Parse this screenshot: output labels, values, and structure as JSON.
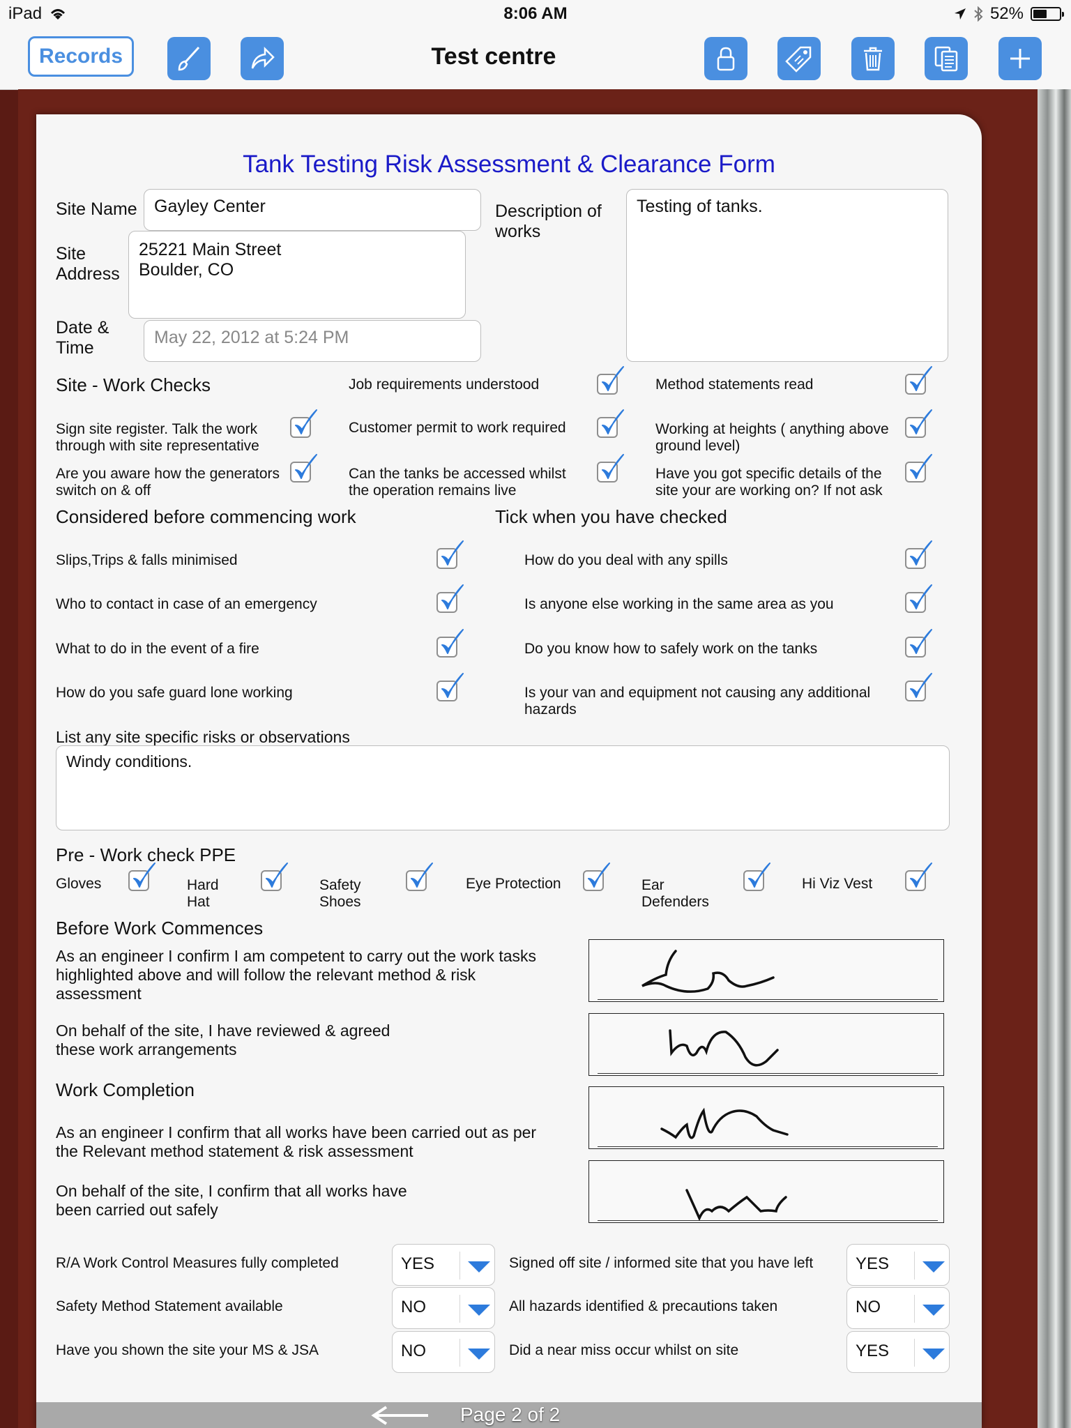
{
  "status_bar": {
    "device": "iPad",
    "time": "8:06 AM",
    "battery": "52%",
    "battery_level": 0.52
  },
  "toolbar": {
    "records_label": "Records",
    "title": "Test centre"
  },
  "form": {
    "title": "Tank Testing Risk Assessment & Clearance Form",
    "site_name_label": "Site Name",
    "site_name_value": "Gayley Center",
    "site_address_label": "Site\nAddress",
    "site_address_value": "25221 Main Street\nBoulder, CO",
    "datetime_label": "Date &\nTime",
    "datetime_value": "May 22, 2012 at 5:24 PM",
    "description_label": "Description of\nworks",
    "description_value": "Testing of tanks.",
    "site_checks_header": "Site - Work Checks",
    "site_checks": [
      {
        "label": "Job requirements understood",
        "checked": true
      },
      {
        "label": "Method statements read",
        "checked": true
      },
      {
        "label": "Sign site register. Talk the work\nthrough with site representative",
        "checked": true
      },
      {
        "label": "Customer permit to work required",
        "checked": true
      },
      {
        "label": "Working at heights ( anything above\nground level)",
        "checked": true
      },
      {
        "label": "Are you aware how the generators\nswitch on & off",
        "checked": true
      },
      {
        "label": "Can the tanks be accessed whilst\nthe operation remains live",
        "checked": true
      },
      {
        "label": "Have you got specific details of the\nsite your are working on? If not ask",
        "checked": true
      }
    ],
    "considered_header": "Considered before commencing work",
    "tick_header": "Tick when you have checked",
    "considered_checks": [
      {
        "label": "Slips,Trips & falls minimised",
        "checked": true
      },
      {
        "label": "Who to contact in case of an emergency",
        "checked": true
      },
      {
        "label": "What to do in the event of a fire",
        "checked": true
      },
      {
        "label": "How do you safe guard lone working",
        "checked": true
      },
      {
        "label": "How do you deal with any spills",
        "checked": true
      },
      {
        "label": "Is anyone else working in the same area as you",
        "checked": true
      },
      {
        "label": "Do you know how to safely work on the tanks",
        "checked": true
      },
      {
        "label": "Is your van and equipment not causing any additional\nhazards",
        "checked": true
      }
    ],
    "risks_label": "List any site specific risks or observations",
    "risks_value": "Windy conditions.",
    "ppe_header": "Pre - Work check PPE",
    "ppe": [
      {
        "label": "Gloves",
        "checked": true
      },
      {
        "label": "Hard\nHat",
        "checked": true
      },
      {
        "label": "Safety\nShoes",
        "checked": true
      },
      {
        "label": "Eye Protection",
        "checked": true
      },
      {
        "label": "Ear\nDefenders",
        "checked": true
      },
      {
        "label": "Hi Viz Vest",
        "checked": true
      }
    ],
    "before_header": "Before Work Commences",
    "engineer_confirm": "As an engineer I confirm I am competent to carry out the work tasks\nhighlighted above and will follow the relevant method & risk\nassessment",
    "site_agree": "On behalf of the site, I have reviewed & agreed\nthese work arrangements",
    "completion_header": "Work Completion",
    "engineer_complete": "As an engineer I confirm that all works have been carried out as per\nthe Relevant method statement & risk assessment",
    "site_complete": "On behalf of the site, I confirm that all works have\nbeen carried out safely",
    "dropdowns": [
      {
        "label": "R/A Work Control Measures fully completed",
        "value": "YES"
      },
      {
        "label": "Signed off site / informed site that you have left",
        "value": "YES"
      },
      {
        "label": "Safety Method Statement available",
        "value": "NO"
      },
      {
        "label": "All hazards identified & precautions taken",
        "value": "NO"
      },
      {
        "label": "Have you shown the site your MS & JSA",
        "value": "NO"
      },
      {
        "label": "Did a near miss occur whilst on site",
        "value": "YES"
      }
    ]
  },
  "footer": {
    "page_label": "Page 2 of 2"
  },
  "icons": {
    "toolbar": [
      "brush-icon",
      "share-icon",
      "lock-icon",
      "tag-icon",
      "trash-icon",
      "copy-icon",
      "plus-icon"
    ],
    "accent": "#4a8fe0",
    "check_color": "#2d7bdc",
    "title_color": "#1a1ac8"
  }
}
